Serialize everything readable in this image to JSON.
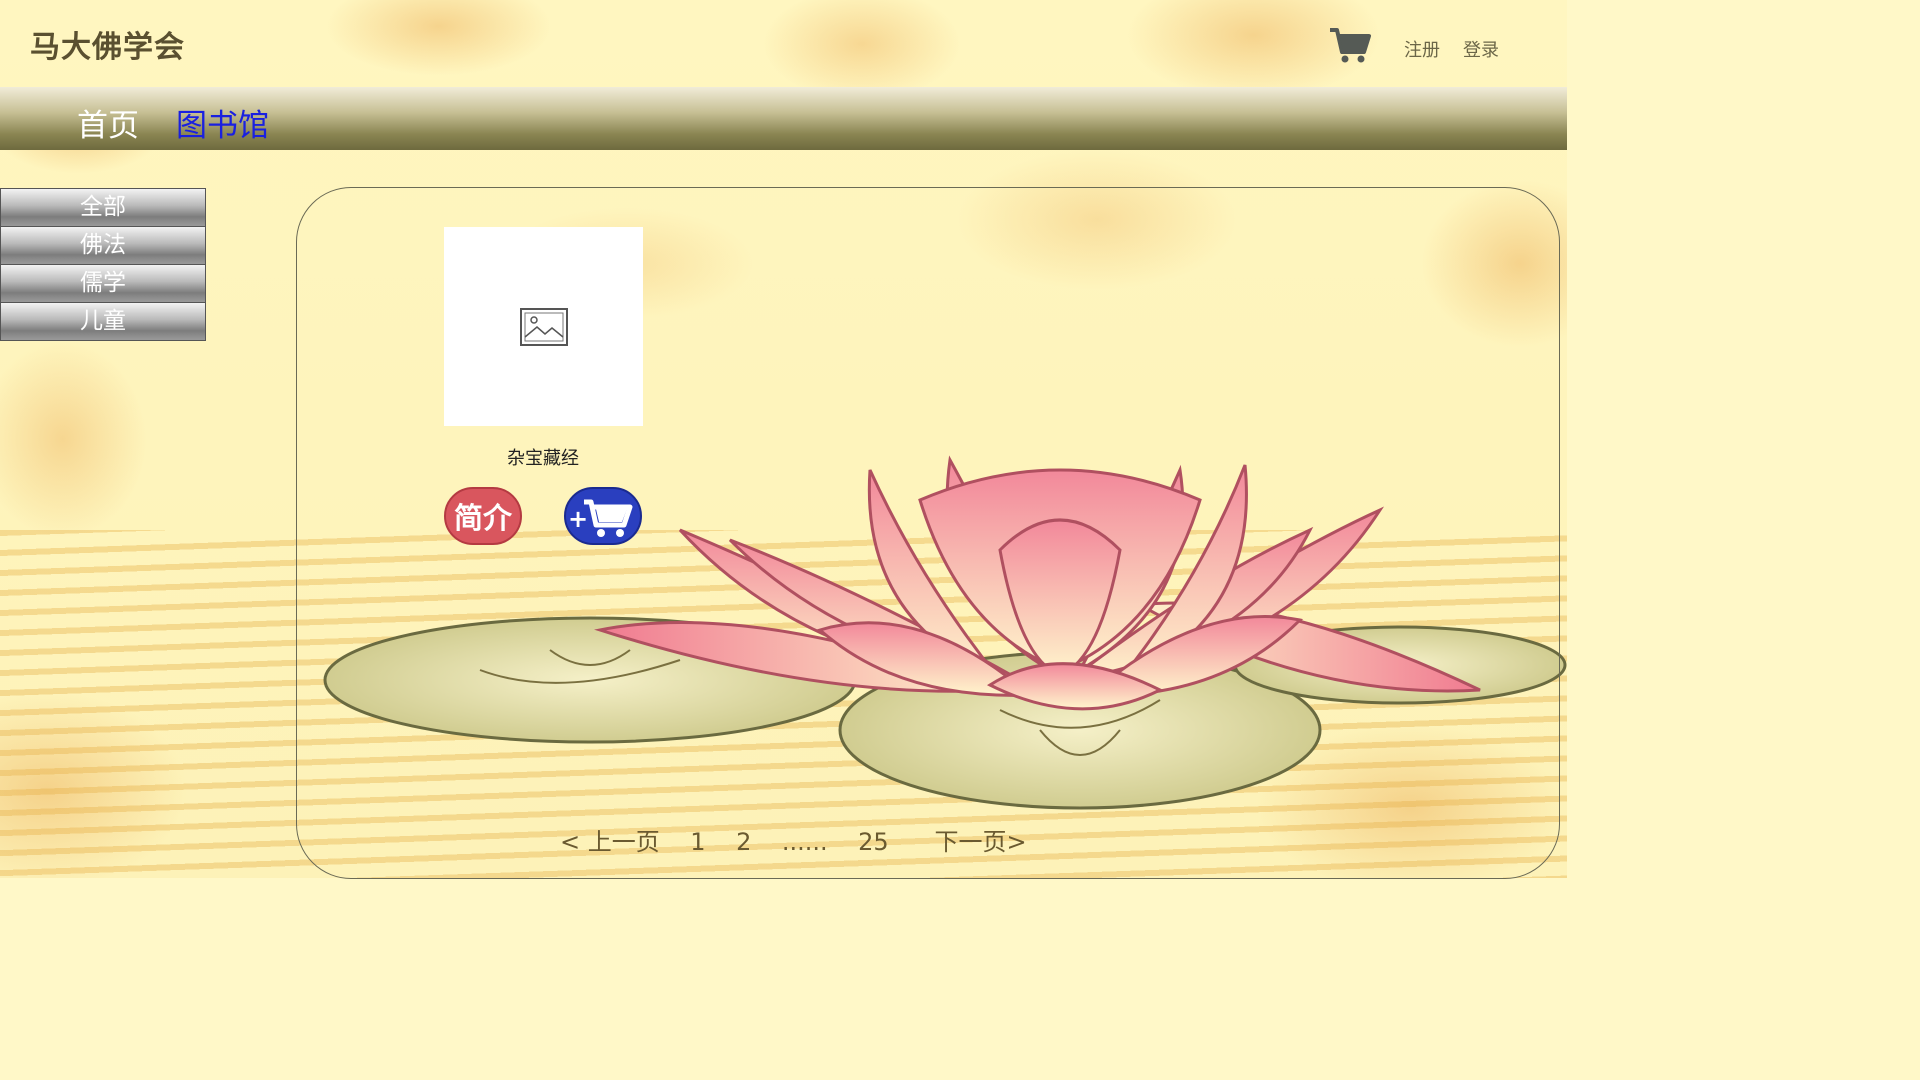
{
  "header": {
    "site_title": "马大佛学会",
    "register": "注册",
    "login": "登录",
    "cart_icon": "shopping-cart-icon"
  },
  "nav": {
    "home": "首页",
    "library": "图书馆"
  },
  "sidebar": {
    "items": [
      {
        "label": "全部"
      },
      {
        "label": "佛法"
      },
      {
        "label": "儒学"
      },
      {
        "label": "儿童"
      }
    ]
  },
  "books": [
    {
      "title": "杂宝藏经",
      "intro_label": "简介",
      "add_cart_label": "+"
    }
  ],
  "pagination": {
    "prev": "< 上一页",
    "pages": [
      "1",
      "2"
    ],
    "ellipsis": "......",
    "last": "25",
    "next": "下一页>"
  },
  "colors": {
    "nav_active": "#1a20e0",
    "intro_button": "#d9565e",
    "cart_button": "#2a3fbf"
  }
}
